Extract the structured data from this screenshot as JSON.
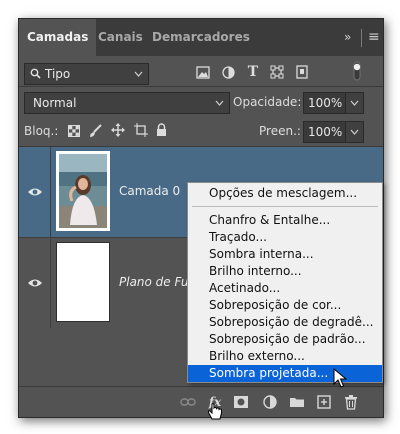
{
  "tabs": [
    "Camadas",
    "Canais",
    "Demarcadores"
  ],
  "panel_menu": {
    "collapse": "»",
    "menu": "≡"
  },
  "filter": {
    "icon": "search-icon",
    "label": "Tipo"
  },
  "blend": {
    "mode": "Normal",
    "opacity_label": "Opacidade:",
    "opacity_value": "100%"
  },
  "lock": {
    "label": "Bloq.:",
    "fill_label": "Preen.:",
    "fill_value": "100%"
  },
  "layers": [
    {
      "name": "Camada 0",
      "selected": true,
      "visible": true
    },
    {
      "name": "Plano de Fundo",
      "selected": false,
      "visible": true
    }
  ],
  "context_menu": {
    "items": [
      "Opções de mesclagem...",
      "Chanfro & Entalhe...",
      "Traçado...",
      "Sombra interna...",
      "Brilho interno...",
      "Acetinado...",
      "Sobreposição de cor...",
      "Sobreposição de degradê...",
      "Sobreposição de padrão...",
      "Brilho externo...",
      "Sombra projetada..."
    ],
    "highlighted": "Sombra projetada..."
  },
  "bottom_icons": [
    "link-icon",
    "fx-icon",
    "mask-icon",
    "adjustment-icon",
    "folder-icon",
    "new-layer-icon",
    "trash-icon"
  ],
  "colors": {
    "panel": "#535353",
    "tabbar": "#3b3b3b",
    "selected_layer": "#486a86",
    "menu_highlight": "#0a64d8"
  }
}
